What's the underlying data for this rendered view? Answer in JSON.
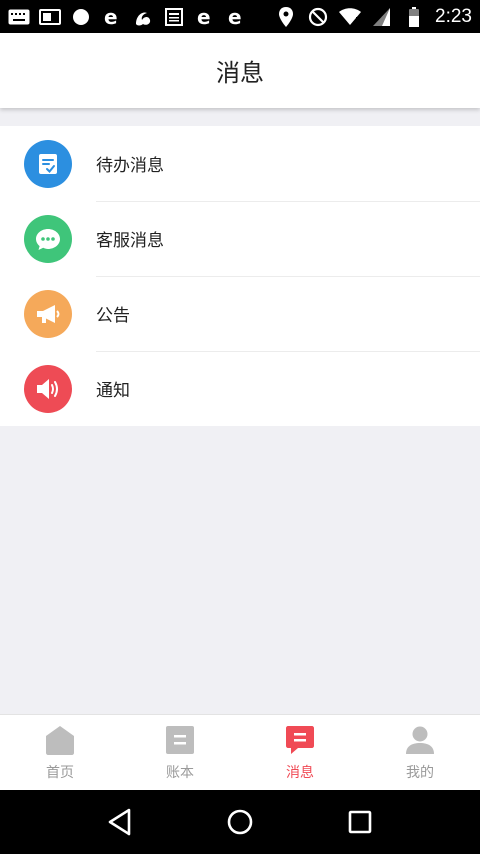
{
  "status_bar": {
    "time": "2:23",
    "left_icons": [
      "keyboard-icon",
      "screen-icon",
      "circle-icon",
      "ie-browser-icon",
      "uc-browser-icon",
      "news-icon",
      "ie-browser-icon",
      "ie-browser-icon"
    ],
    "right_icons": [
      "location-icon",
      "do-not-disturb-icon",
      "wifi-icon",
      "signal-icon",
      "battery-icon"
    ]
  },
  "header": {
    "title": "消息"
  },
  "messages": [
    {
      "label": "待办消息",
      "icon": "todo-icon",
      "color": "#2c8fe0"
    },
    {
      "label": "客服消息",
      "icon": "chat-icon",
      "color": "#3fc57a"
    },
    {
      "label": "公告",
      "icon": "megaphone-icon",
      "color": "#f5a95a"
    },
    {
      "label": "通知",
      "icon": "speaker-icon",
      "color": "#ee4b55"
    }
  ],
  "tabs": [
    {
      "label": "首页",
      "icon": "home-icon",
      "active": false
    },
    {
      "label": "账本",
      "icon": "ledger-icon",
      "active": false
    },
    {
      "label": "消息",
      "icon": "message-icon",
      "active": true
    },
    {
      "label": "我的",
      "icon": "profile-icon",
      "active": false
    }
  ],
  "colors": {
    "accent": "#f04a55",
    "inactive": "#bdbdbd",
    "background": "#f0f0f4"
  }
}
